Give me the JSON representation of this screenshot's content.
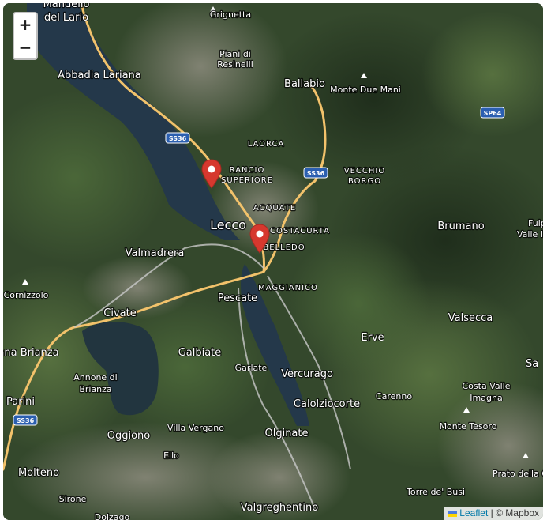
{
  "map": {
    "zoom_in_label": "+",
    "zoom_out_label": "−",
    "attribution": {
      "leaflet": "Leaflet",
      "separator": "|",
      "copyright": "© Mapbox"
    },
    "road_color": "#f2c26b",
    "water_color": "#24384a",
    "labels": {
      "mandello_1": "Mandello",
      "mandello_2": "del Lario",
      "grignetta": "Grignetta",
      "piani_1": "Piani di",
      "piani_2": "Resinelli",
      "abbadia": "Abbadia Lariana",
      "ballabio": "Ballabio",
      "monte_due_mani": "Monte Due Mani",
      "laorca": "LAORCA",
      "rancio_1": "RANCIO",
      "rancio_2": "SUPERIORE",
      "vecchio_1": "VECCHIO",
      "vecchio_2": "BORGO",
      "acquate": "ACQUATE",
      "lecco": "Lecco",
      "costacurta": "COSTACURTA",
      "belledo": "BELLEDO",
      "brumano": "Brumano",
      "fuip_1": "Fuip",
      "fuip_2": "Valle I",
      "valmadrera": "Valmadrera",
      "maggianico": "MAGGIANICO",
      "cornizzolo": "Cornizzolo",
      "pescate": "Pescate",
      "civate": "Civate",
      "valsecca": "Valsecca",
      "erve": "Erve",
      "brianza": "ana Brianza",
      "galbiate": "Galbiate",
      "sa": "Sa",
      "garlate": "Garlate",
      "vercurago": "Vercurago",
      "annone_1": "Annone di",
      "annone_2": "Brianza",
      "carenno": "Carenno",
      "costa_1": "Costa Valle",
      "costa_2": "Imagna",
      "parini": "Parini",
      "calolzio": "Calolziocorte",
      "monte_tesoro": "Monte Tesoro",
      "oggiono": "Oggiono",
      "villa_vergano": "Villa Vergano",
      "olginate": "Olginate",
      "ello": "Ello",
      "prato": "Prato della C",
      "molteno": "Molteno",
      "sirone": "Sirone",
      "torre": "Torre de' Busi",
      "valgreghentino": "Valgreghentino",
      "dolzago": "Dolzago"
    },
    "shields": [
      "SS36",
      "SS36",
      "SP64",
      "SS36"
    ],
    "markers": [
      {
        "name": "marker-rancio"
      },
      {
        "name": "marker-belledo"
      }
    ]
  }
}
